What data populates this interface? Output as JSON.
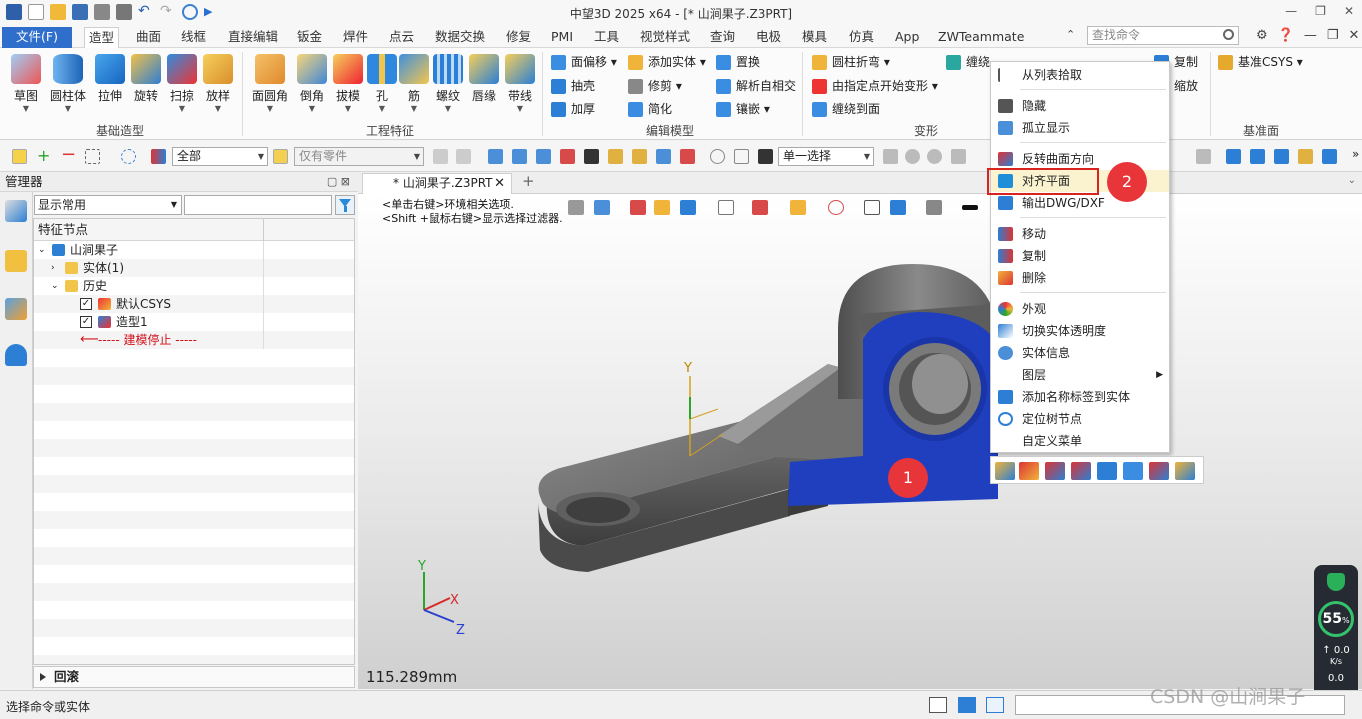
{
  "window": {
    "title": "中望3D 2025 x64 - [* 山涧果子.Z3PRT]",
    "controls": [
      "—",
      "❐",
      "✕"
    ]
  },
  "menu": {
    "file": "文件(F)",
    "tabs": [
      "造型",
      "曲面",
      "线框",
      "直接编辑",
      "钣金",
      "焊件",
      "点云",
      "数据交换",
      "修复",
      "PMI",
      "工具",
      "视觉样式",
      "查询",
      "电极",
      "模具",
      "仿真",
      "App",
      "ZWTeammate"
    ],
    "active_tab": "造型",
    "search_placeholder": "查找命令"
  },
  "ribbon": {
    "group_basic": {
      "label": "基础造型",
      "buttons": [
        "草图",
        "圆柱体",
        "拉伸",
        "旋转",
        "扫掠",
        "放样"
      ]
    },
    "group_eng": {
      "label": "工程特征",
      "buttons": [
        "面圆角",
        "倒角",
        "拔模",
        "孔",
        "筋",
        "螺纹",
        "唇缘",
        "带线"
      ]
    },
    "group_edit": {
      "label": "编辑模型",
      "items": [
        "面偏移",
        "添加实体",
        "置换",
        "抽壳",
        "修剪",
        "解析自相交",
        "加厚",
        "简化",
        "镶嵌"
      ]
    },
    "group_deform": {
      "label": "变形",
      "items": [
        "圆柱折弯",
        "缠绕阵列环",
        "由指定点开始变形",
        "缠绕到面"
      ]
    },
    "group_basic2": {
      "items": [
        "复制",
        "缩放"
      ]
    },
    "group_datum": {
      "label": "基准面",
      "items": [
        "基准CSYS"
      ]
    }
  },
  "toolbar": {
    "filter_all": "全部",
    "parts_only": "仅有零件",
    "select_mode": "单一选择"
  },
  "manager": {
    "title": "管理器",
    "filter_value": "显示常用",
    "column_header": "特征节点",
    "tree": [
      {
        "label": "山涧果子"
      },
      {
        "label": "实体(1)"
      },
      {
        "label": "历史"
      },
      {
        "label": "默认CSYS"
      },
      {
        "label": "造型1"
      },
      {
        "label": "----- 建模停止 -----"
      }
    ],
    "rollback": "回滚"
  },
  "document": {
    "tab_label": "* 山涧果子.Z3PRT"
  },
  "viewport": {
    "hint_line1": "<单击右键>环境相关选项.",
    "hint_line2": "<Shift +鼠标右键>显示选择过滤器.",
    "scale": "115.289mm",
    "axis_x": "X",
    "axis_y": "Y",
    "axis_z": "Z"
  },
  "context_menu": {
    "items": [
      "从列表拾取",
      "隐藏",
      "孤立显示",
      "反转曲面方向",
      "对齐平面",
      "输出DWG/DXF",
      "移动",
      "复制",
      "删除",
      "外观",
      "切换实体透明度",
      "实体信息",
      "图层",
      "添加名称标签到实体",
      "定位树节点",
      "自定义菜单"
    ],
    "highlighted": "对齐平面"
  },
  "badges": {
    "step1": "1",
    "step2": "2"
  },
  "perf": {
    "percent": "55",
    "percent_unit": "%",
    "up_rate": "0.0",
    "up_unit": "K/s",
    "down_rate": "0.0"
  },
  "status": {
    "text": "选择命令或实体"
  },
  "watermark": "CSDN @山涧果子",
  "colors": {
    "accent": "#2f6fcb",
    "selected_face": "#1f3fbf",
    "badge": "#e8353a",
    "highlight_border": "#d8231e"
  }
}
